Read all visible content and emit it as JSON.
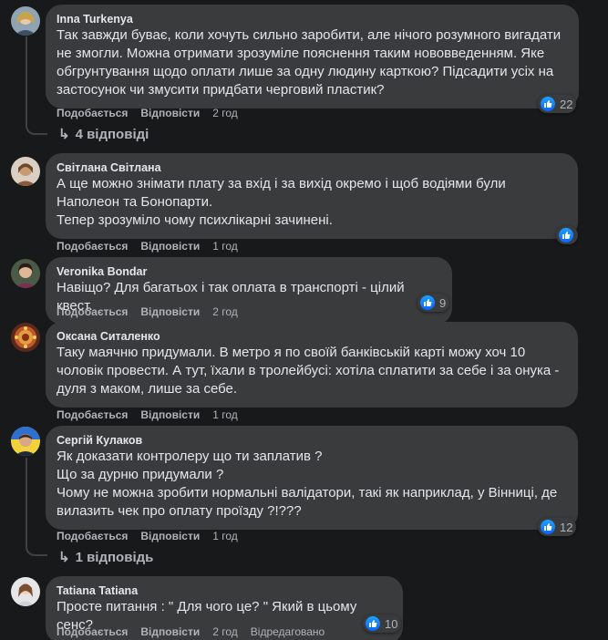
{
  "actions": {
    "like": "Подобається",
    "reply": "Відповісти"
  },
  "comments": [
    {
      "author": "Inna Turkenya",
      "text": "Так завжди буває, коли хочуть сильно заробити, але нічого розумного вигадати\nне змогли. Можна отримати зрозуміле пояснення таким нововведенням. Яке\nобгрунтування щодо оплати лише за одну людину карткою? Підсадити усіх на\nзастосунок чи змусити придбати черговий пластик?",
      "time": "2 год",
      "reactions": "22",
      "replies": "4 відповіді"
    },
    {
      "author": "Світлана Світлана",
      "text": "А ще можно знімати плату за вхід і за вихід окремо і щоб водіями були\nНаполеон та Бонопарти.\nТепер зрозуміло чому психлікарні зачинені.",
      "time": "1 год",
      "reactions": ""
    },
    {
      "author": "Veronika Bondar",
      "text": "Навіщо? Для багатьох і так оплата в транспорті - цілий квест.",
      "time": "2 год",
      "reactions": "9"
    },
    {
      "author": "Оксана Ситаленко",
      "text": "Таку маячню придумали. В метро я по своїй банківській карті можу хоч 10\nчоловік провести. А тут, їхали в тролейбусі: хотіла сплатити за себе і за онука -\nдуля з маком, лише за себе.",
      "time": "1 год",
      "reactions": ""
    },
    {
      "author": "Сергій Кулаков",
      "text": "Як доказати контролеру що ти заплатив ?\nЩо за дурню придумали ?\nЧому не можна зробити нормальні валідатори, такі як наприклад, у Вінниці, де\nвилазить чек про оплату проїзду ?!???",
      "time": "1 год",
      "reactions": "12",
      "replies": "1 відповідь"
    },
    {
      "author": "Tatiana Tatiana",
      "text": "Просте питання : \" Для чого це? \" Який в цьому сенс?",
      "time": "2 год",
      "edited": "Відредаговано",
      "reactions": "10"
    }
  ],
  "colors": {
    "background": "#18191a",
    "bubble": "#3a3b3c",
    "like": "#0866ff",
    "muted": "#b0b3b8"
  }
}
